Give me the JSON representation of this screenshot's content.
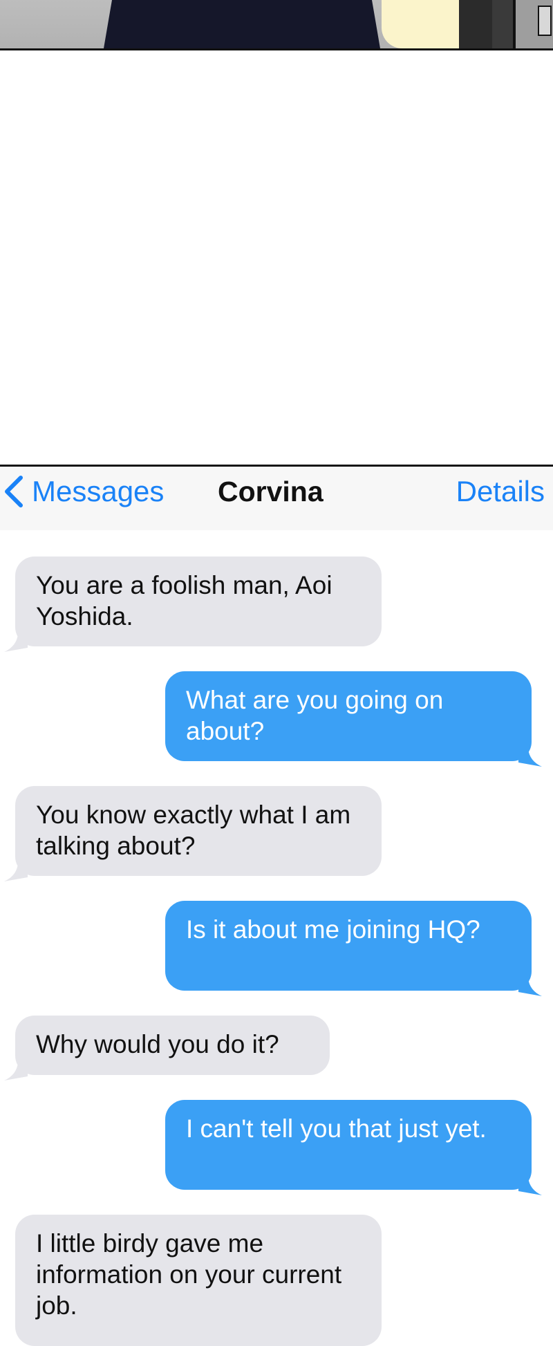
{
  "nav": {
    "back_label": "Messages",
    "title": "Corvina",
    "details_label": "Details"
  },
  "colors": {
    "accent": "#1a82f7",
    "outgoing_bubble": "#3ba0f5",
    "incoming_bubble": "#e5e5ea",
    "navbar_bg": "#f7f7f7"
  },
  "icons": {
    "back": "chevron-left-icon"
  },
  "messages": [
    {
      "direction": "incoming",
      "text": "You are a foolish man, Aoi Yoshida."
    },
    {
      "direction": "outgoing",
      "text": "What are you going on about?"
    },
    {
      "direction": "incoming",
      "text": "You know exactly what I am talking about?"
    },
    {
      "direction": "outgoing",
      "text": "Is it about me joining HQ?"
    },
    {
      "direction": "incoming",
      "text": "Why would you do it?"
    },
    {
      "direction": "outgoing",
      "text": "I can't tell you that just yet."
    },
    {
      "direction": "incoming",
      "text": "I little birdy gave me information on your current job."
    }
  ]
}
